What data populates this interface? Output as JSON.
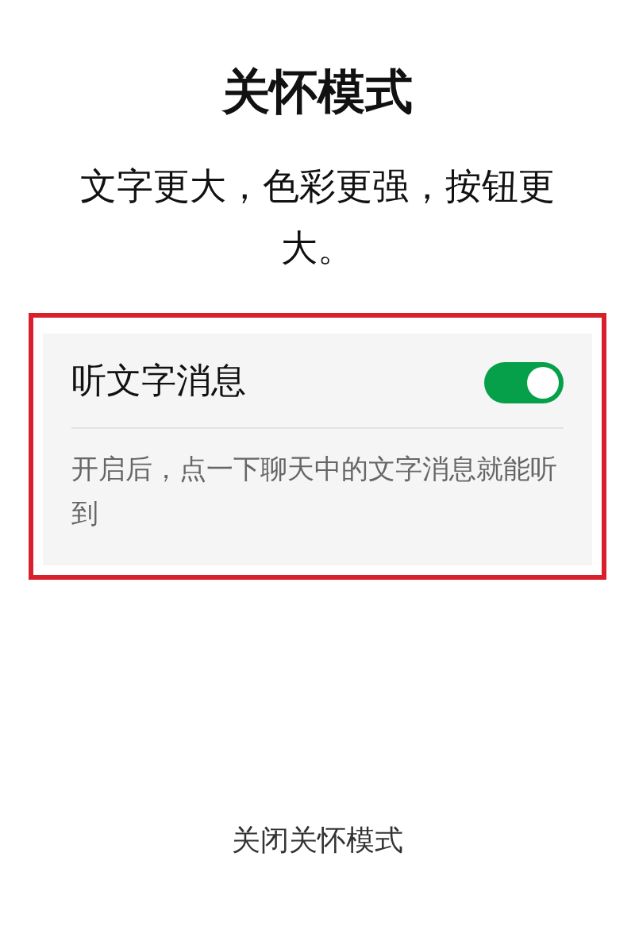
{
  "title": "关怀模式",
  "subtitle": "文字更大，色彩更强，按钮更大。",
  "setting": {
    "label": "听文字消息",
    "on": true,
    "description": "开启后，点一下聊天中的文字消息就能听到",
    "highlighted": true
  },
  "footer_link": "关闭关怀模式"
}
